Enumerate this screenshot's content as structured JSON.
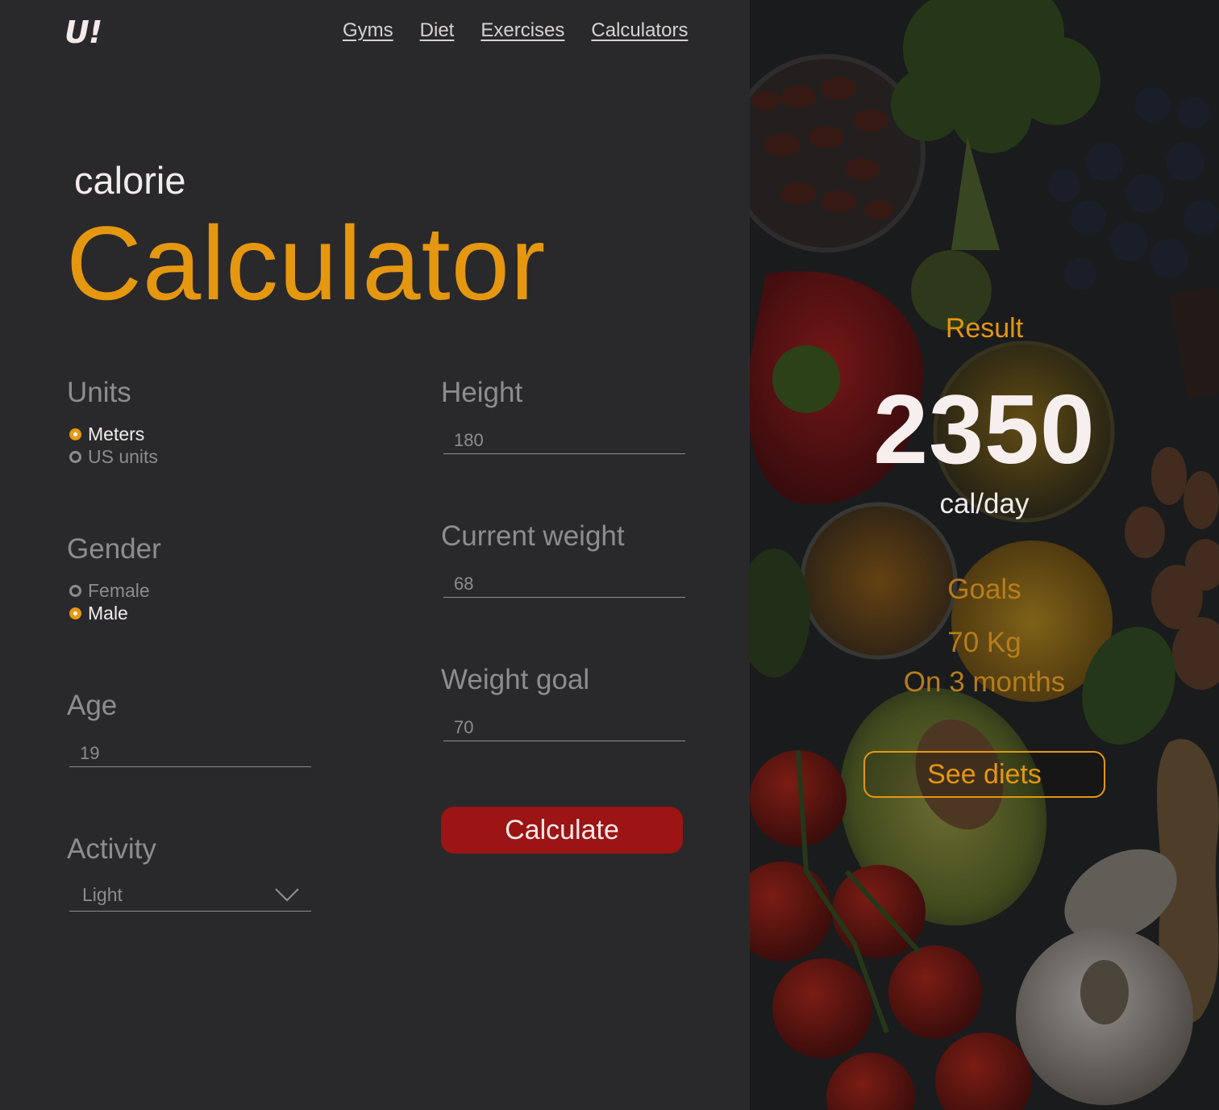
{
  "header": {
    "logo": "U!",
    "nav": [
      "Gyms",
      "Diet",
      "Exercises",
      "Calculators"
    ]
  },
  "hero": {
    "eyebrow": "calorie",
    "title": "Calculator"
  },
  "form": {
    "units": {
      "label": "Units",
      "options": [
        "Meters",
        "US units"
      ],
      "selected": "Meters"
    },
    "gender": {
      "label": "Gender",
      "options": [
        "Female",
        "Male"
      ],
      "selected": "Male"
    },
    "age": {
      "label": "Age",
      "value": "19"
    },
    "activity": {
      "label": "Activity",
      "value": "Light"
    },
    "height": {
      "label": "Height",
      "value": "180"
    },
    "current_weight": {
      "label": "Current weight",
      "value": "68"
    },
    "weight_goal": {
      "label": "Weight goal",
      "value": "70"
    },
    "calculate_label": "Calculate"
  },
  "result": {
    "title": "Result",
    "value": "2350",
    "unit": "cal/day",
    "goals_title": "Goals",
    "goal_weight": "70 Kg",
    "goal_time": "On 3 months",
    "see_diets_label": "See diets"
  },
  "colors": {
    "background": "#29292b",
    "accent": "#e5970f",
    "button_red": "#9c1414",
    "text_muted": "#8d8d8f",
    "text_light": "#f2ecec"
  }
}
